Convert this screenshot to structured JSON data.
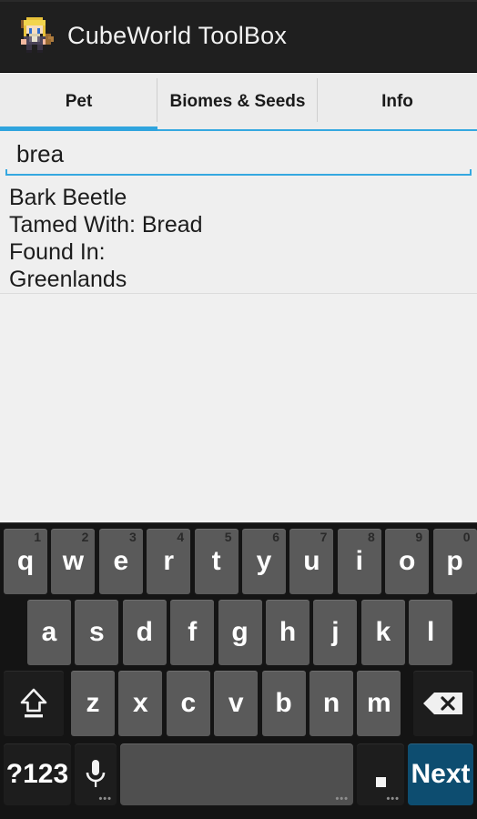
{
  "app": {
    "title": "CubeWorld ToolBox",
    "icon_name": "cubeworld-character-icon"
  },
  "tabs": [
    {
      "label": "Pet",
      "active": true
    },
    {
      "label": "Biomes & Seeds",
      "active": false
    },
    {
      "label": "Info",
      "active": false
    }
  ],
  "search": {
    "value": "brea",
    "placeholder": ""
  },
  "result": {
    "lines": [
      "Bark Beetle",
      "Tamed With: Bread",
      "Found In:",
      "Greenlands"
    ]
  },
  "keyboard": {
    "row1": [
      {
        "key": "q",
        "hint": "1"
      },
      {
        "key": "w",
        "hint": "2"
      },
      {
        "key": "e",
        "hint": "3"
      },
      {
        "key": "r",
        "hint": "4"
      },
      {
        "key": "t",
        "hint": "5"
      },
      {
        "key": "y",
        "hint": "6"
      },
      {
        "key": "u",
        "hint": "7"
      },
      {
        "key": "i",
        "hint": "8"
      },
      {
        "key": "o",
        "hint": "9"
      },
      {
        "key": "p",
        "hint": "0"
      }
    ],
    "row2": [
      {
        "key": "a"
      },
      {
        "key": "s"
      },
      {
        "key": "d"
      },
      {
        "key": "f"
      },
      {
        "key": "g"
      },
      {
        "key": "h"
      },
      {
        "key": "j"
      },
      {
        "key": "k"
      },
      {
        "key": "l"
      }
    ],
    "row3": [
      {
        "key": "z"
      },
      {
        "key": "x"
      },
      {
        "key": "c"
      },
      {
        "key": "v"
      },
      {
        "key": "b"
      },
      {
        "key": "n"
      },
      {
        "key": "m"
      }
    ],
    "shift_label": "",
    "backspace_label": "",
    "symbols_label": "?123",
    "mic_label": "",
    "space_label": "",
    "period_label": "",
    "enter_label": "Next"
  },
  "colors": {
    "actionbar_bg": "#1f1f1f",
    "accent_blue": "#35a8e0",
    "page_bg": "#efefef",
    "keyboard_bg": "#141414",
    "key_bg": "#5a5a5a",
    "func_key_bg": "#1d1d1d",
    "enter_key_bg": "#0d4d70",
    "text_primary": "#1c1c1c"
  }
}
